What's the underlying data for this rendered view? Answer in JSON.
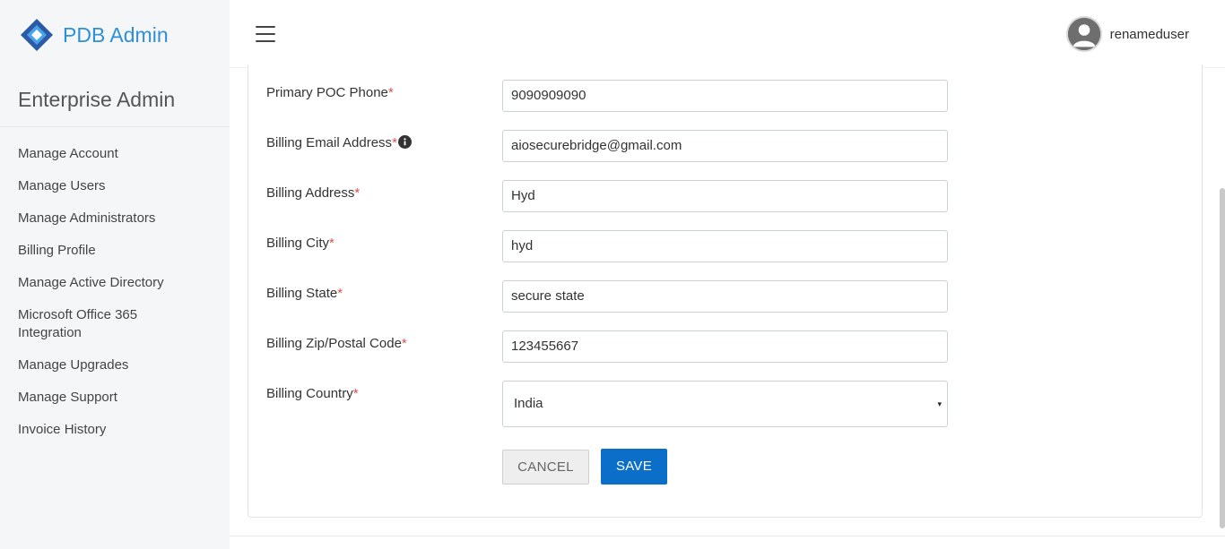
{
  "brand": {
    "name": "PDB Admin",
    "logo_icon": "diamond-logo-icon"
  },
  "sidebar": {
    "section_title": "Enterprise Admin",
    "items": [
      {
        "label": "Manage Account"
      },
      {
        "label": "Manage Users"
      },
      {
        "label": "Manage Administrators"
      },
      {
        "label": "Billing Profile"
      },
      {
        "label": "Manage Active Directory"
      },
      {
        "label": "Microsoft Office 365",
        "label2": "Integration"
      },
      {
        "label": "Manage Upgrades"
      },
      {
        "label": "Manage Support"
      },
      {
        "label": "Invoice History"
      }
    ]
  },
  "header": {
    "menu_icon": "hamburger-menu-icon",
    "username": "renameduser",
    "avatar_icon": "user-avatar-icon"
  },
  "form": {
    "required_marker": "*",
    "fields": {
      "poc_phone": {
        "label": "Primary POC Phone",
        "value": "9090909090"
      },
      "billing_email": {
        "label": "Billing Email Address",
        "value": "aiosecurebridge@gmail.com",
        "info_icon": "info-circle-icon"
      },
      "billing_address": {
        "label": "Billing Address",
        "value": "Hyd"
      },
      "billing_city": {
        "label": "Billing City",
        "value": "hyd"
      },
      "billing_state": {
        "label": "Billing State",
        "value": "secure state"
      },
      "billing_zip": {
        "label": "Billing Zip/Postal Code",
        "value": "123455667"
      },
      "billing_country": {
        "label": "Billing Country",
        "value": "India",
        "caret": "▾"
      }
    },
    "cancel_label": "CANCEL",
    "save_label": "SAVE"
  },
  "colors": {
    "brand": "#2f8fd8",
    "primary_button": "#0b6fca",
    "required": "#d9534f",
    "sidebar_bg": "#f4f6f8"
  }
}
